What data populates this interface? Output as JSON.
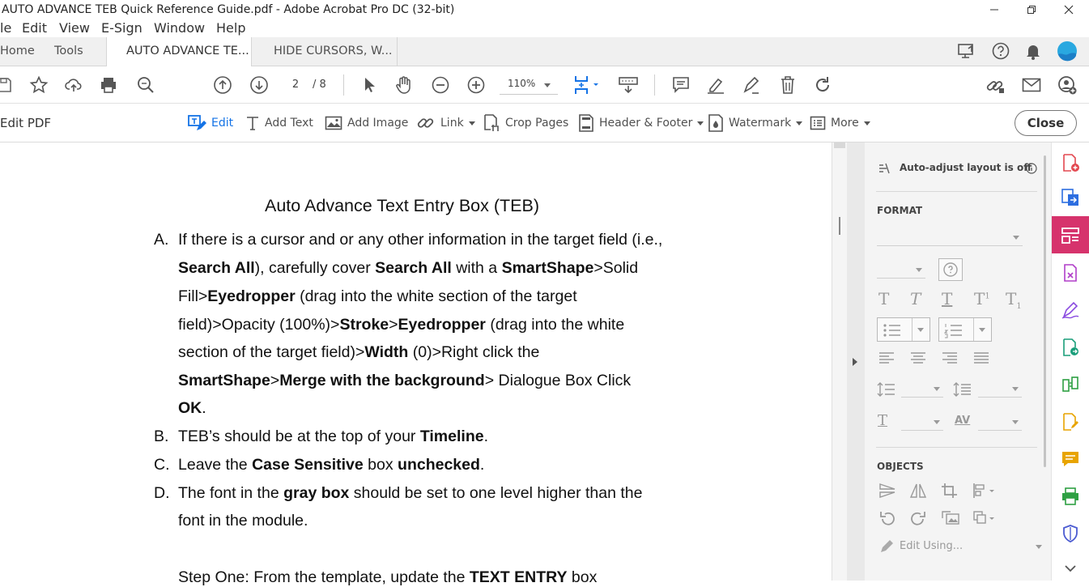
{
  "window": {
    "title": "AUTO ADVANCE TEB Quick Reference Guide.pdf - Adobe Acrobat Pro DC (32-bit)",
    "minimize_icon": "minimize-icon",
    "maximize_icon": "restore-icon",
    "close_icon": "close-icon"
  },
  "menu": [
    "le",
    "Edit",
    "View",
    "E-Sign",
    "Window",
    "Help"
  ],
  "tabs": {
    "home": "Home",
    "tools": "Tools",
    "doc1": "AUTO ADVANCE TE...",
    "doc2": "HIDE CURSORS, W..."
  },
  "toolbar": {
    "page_current": "2",
    "page_total": "/ 8",
    "zoom": "110%"
  },
  "editbar": {
    "title": "Edit PDF",
    "edit": "Edit",
    "add_text": "Add Text",
    "add_image": "Add Image",
    "link": "Link",
    "crop_pages": "Crop Pages",
    "header_footer": "Header & Footer",
    "watermark": "Watermark",
    "more": "More",
    "close": "Close"
  },
  "document": {
    "heading": "Auto Advance Text Entry Box (TEB)",
    "items": {
      "a_marker": "A.",
      "a_l1": "If there is a cursor and or any other information in the target field (i.e.,",
      "a_l2_b1": "Search All",
      "a_l2_t1": "), carefully cover ",
      "a_l2_b2": "Search All",
      "a_l2_t2": " with a ",
      "a_l2_b3": "SmartShape",
      "a_l2_t3": ">Solid",
      "a_l3_t1": "Fill>",
      "a_l3_b1": "Eyedropper",
      "a_l3_t2": " (drag into the white section of the target",
      "a_l4_t1": "field)>Opacity (100%)>",
      "a_l4_b1": "Stroke",
      "a_l4_t2": ">",
      "a_l4_b2": "Eyedropper",
      "a_l4_t3": " (drag into the white",
      "a_l5_t1": "section of the target field)>",
      "a_l5_b1": "Width",
      "a_l5_t2": " (0)>Right click the",
      "a_l6_b1": "SmartShape",
      "a_l6_t1": ">",
      "a_l6_b2": "Merge with the background",
      "a_l6_t2": "> Dialogue Box Click",
      "a_l7_b1": "OK",
      "a_l7_t1": ".",
      "b_marker": "B.",
      "b_t1": "TEB’s should be at the top of your ",
      "b_b1": "Timeline",
      "b_t2": ".",
      "c_marker": "C.",
      "c_t1": "Leave the ",
      "c_b1": "Case Sensitive",
      "c_t2": " box ",
      "c_b2": "unchecked",
      "c_t3": ".",
      "d_marker": "D.",
      "d_t1": "The font in the ",
      "d_b1": "gray box",
      "d_t2": " should be set to one level higher than the",
      "d_l2": "font in the module.",
      "step_t1": "Step One: From the template, update the ",
      "step_b1": "TEXT ENTRY",
      "step_t2": " box"
    }
  },
  "panel": {
    "auto_adjust": "Auto-adjust layout is off",
    "format": "FORMAT",
    "objects": "OBJECTS",
    "edit_using": "Edit Using..."
  },
  "colors": {
    "accent_blue": "#1473e6",
    "rail_active": "#d6336c"
  }
}
